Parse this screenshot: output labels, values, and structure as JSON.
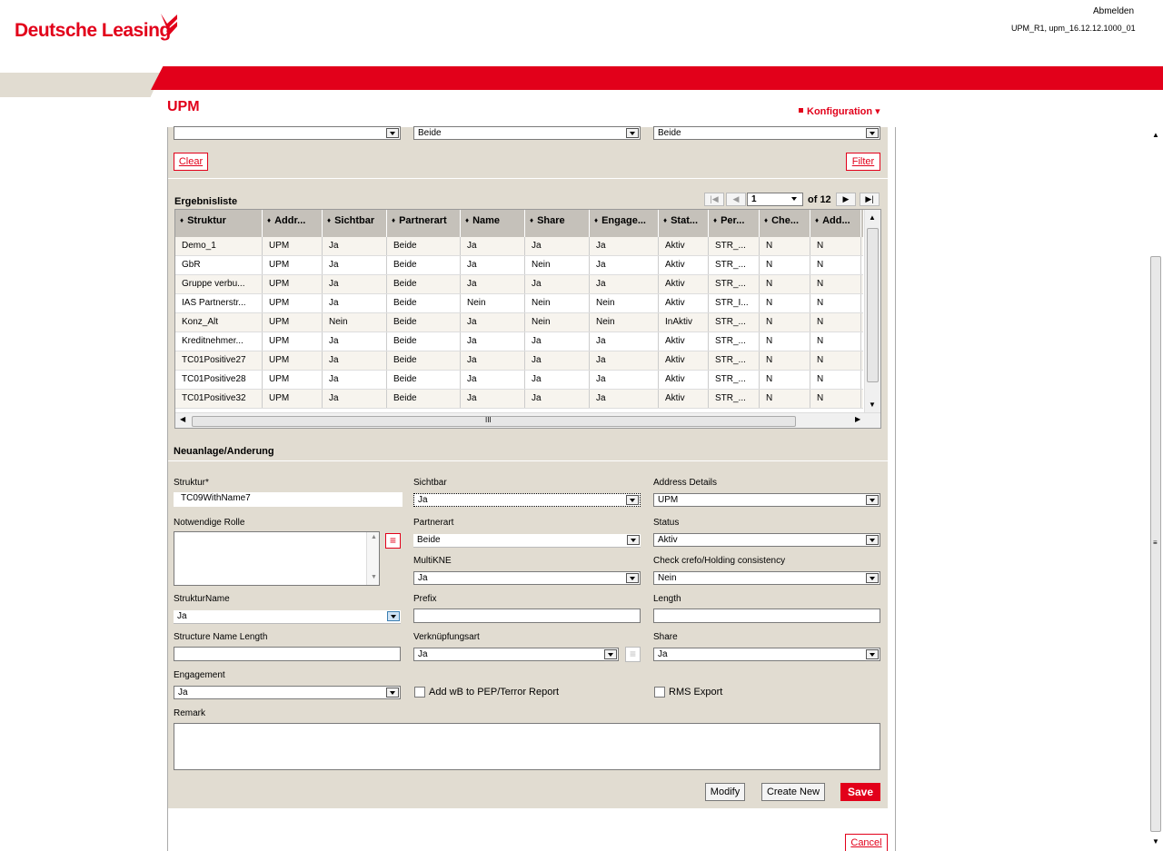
{
  "header": {
    "brand": "Deutsche Leasing",
    "logout": "Abmelden",
    "user_info": "UPM_R1, upm_16.12.12.1000_01",
    "app_title": "UPM",
    "config_menu": "Konfiguration"
  },
  "filter": {
    "select1": "",
    "select2": "Beide",
    "select3": "Beide",
    "clear_label": "Clear",
    "filter_label": "Filter"
  },
  "results": {
    "title": "Ergebnisliste",
    "page": "1",
    "of_pages": "of 12",
    "columns": [
      "Struktur",
      "Addr...",
      "Sichtbar",
      "Partnerart",
      "Name",
      "Share",
      "Engage...",
      "Stat...",
      "Per...",
      "Che...",
      "Add..."
    ],
    "rows": [
      [
        "Demo_1",
        "UPM",
        "Ja",
        "Beide",
        "Ja",
        "Ja",
        "Ja",
        "Aktiv",
        "STR_...",
        "N",
        "N"
      ],
      [
        "GbR",
        "UPM",
        "Ja",
        "Beide",
        "Ja",
        "Nein",
        "Ja",
        "Aktiv",
        "STR_...",
        "N",
        "N"
      ],
      [
        "Gruppe verbu...",
        "UPM",
        "Ja",
        "Beide",
        "Ja",
        "Ja",
        "Ja",
        "Aktiv",
        "STR_...",
        "N",
        "N"
      ],
      [
        "IAS Partnerstr...",
        "UPM",
        "Ja",
        "Beide",
        "Nein",
        "Nein",
        "Nein",
        "Aktiv",
        "STR_I...",
        "N",
        "N"
      ],
      [
        "Konz_Alt",
        "UPM",
        "Nein",
        "Beide",
        "Ja",
        "Nein",
        "Nein",
        "InAktiv",
        "STR_...",
        "N",
        "N"
      ],
      [
        "Kreditnehmer...",
        "UPM",
        "Ja",
        "Beide",
        "Ja",
        "Ja",
        "Ja",
        "Aktiv",
        "STR_...",
        "N",
        "N"
      ],
      [
        "TC01Positive27",
        "UPM",
        "Ja",
        "Beide",
        "Ja",
        "Ja",
        "Ja",
        "Aktiv",
        "STR_...",
        "N",
        "N"
      ],
      [
        "TC01Positive28",
        "UPM",
        "Ja",
        "Beide",
        "Ja",
        "Ja",
        "Ja",
        "Aktiv",
        "STR_...",
        "N",
        "N"
      ],
      [
        "TC01Positive32",
        "UPM",
        "Ja",
        "Beide",
        "Ja",
        "Ja",
        "Ja",
        "Aktiv",
        "STR_...",
        "N",
        "N"
      ]
    ],
    "scroll_grip": "III"
  },
  "form": {
    "title": "Neuanlage/Anderung",
    "struktur": {
      "label": "Struktur*",
      "value": "TC09WithName7"
    },
    "sichtbar": {
      "label": "Sichtbar",
      "value": "Ja"
    },
    "address_details": {
      "label": "Address Details",
      "value": "UPM"
    },
    "notwendige_rolle": {
      "label": "Notwendige Rolle",
      "value": ""
    },
    "partnerart": {
      "label": "Partnerart",
      "value": "Beide"
    },
    "status": {
      "label": "Status",
      "value": "Aktiv"
    },
    "multikne": {
      "label": "MultiKNE",
      "value": "Ja"
    },
    "check_crefo": {
      "label": "Check crefo/Holding consistency",
      "value": "Nein"
    },
    "strukturname": {
      "label": "StrukturName",
      "value": "Ja"
    },
    "prefix": {
      "label": "Prefix",
      "value": ""
    },
    "length": {
      "label": "Length",
      "value": ""
    },
    "structure_name_length": {
      "label": "Structure Name Length",
      "value": ""
    },
    "verknuepfungsart": {
      "label": "Verknüpfungsart",
      "value": "Ja"
    },
    "share": {
      "label": "Share",
      "value": "Ja"
    },
    "engagement": {
      "label": "Engagement",
      "value": "Ja"
    },
    "add_wb": {
      "label": "Add wB to PEP/Terror Report",
      "checked": false
    },
    "rms_export": {
      "label": "RMS Export",
      "checked": false
    },
    "remark": {
      "label": "Remark",
      "value": ""
    }
  },
  "actions": {
    "modify": "Modify",
    "create_new": "Create New",
    "save": "Save",
    "cancel": "Cancel"
  },
  "colors": {
    "brand_red": "#e2001a",
    "panel_beige": "#e1dcd1",
    "grid_header": "#c5c1ba"
  }
}
